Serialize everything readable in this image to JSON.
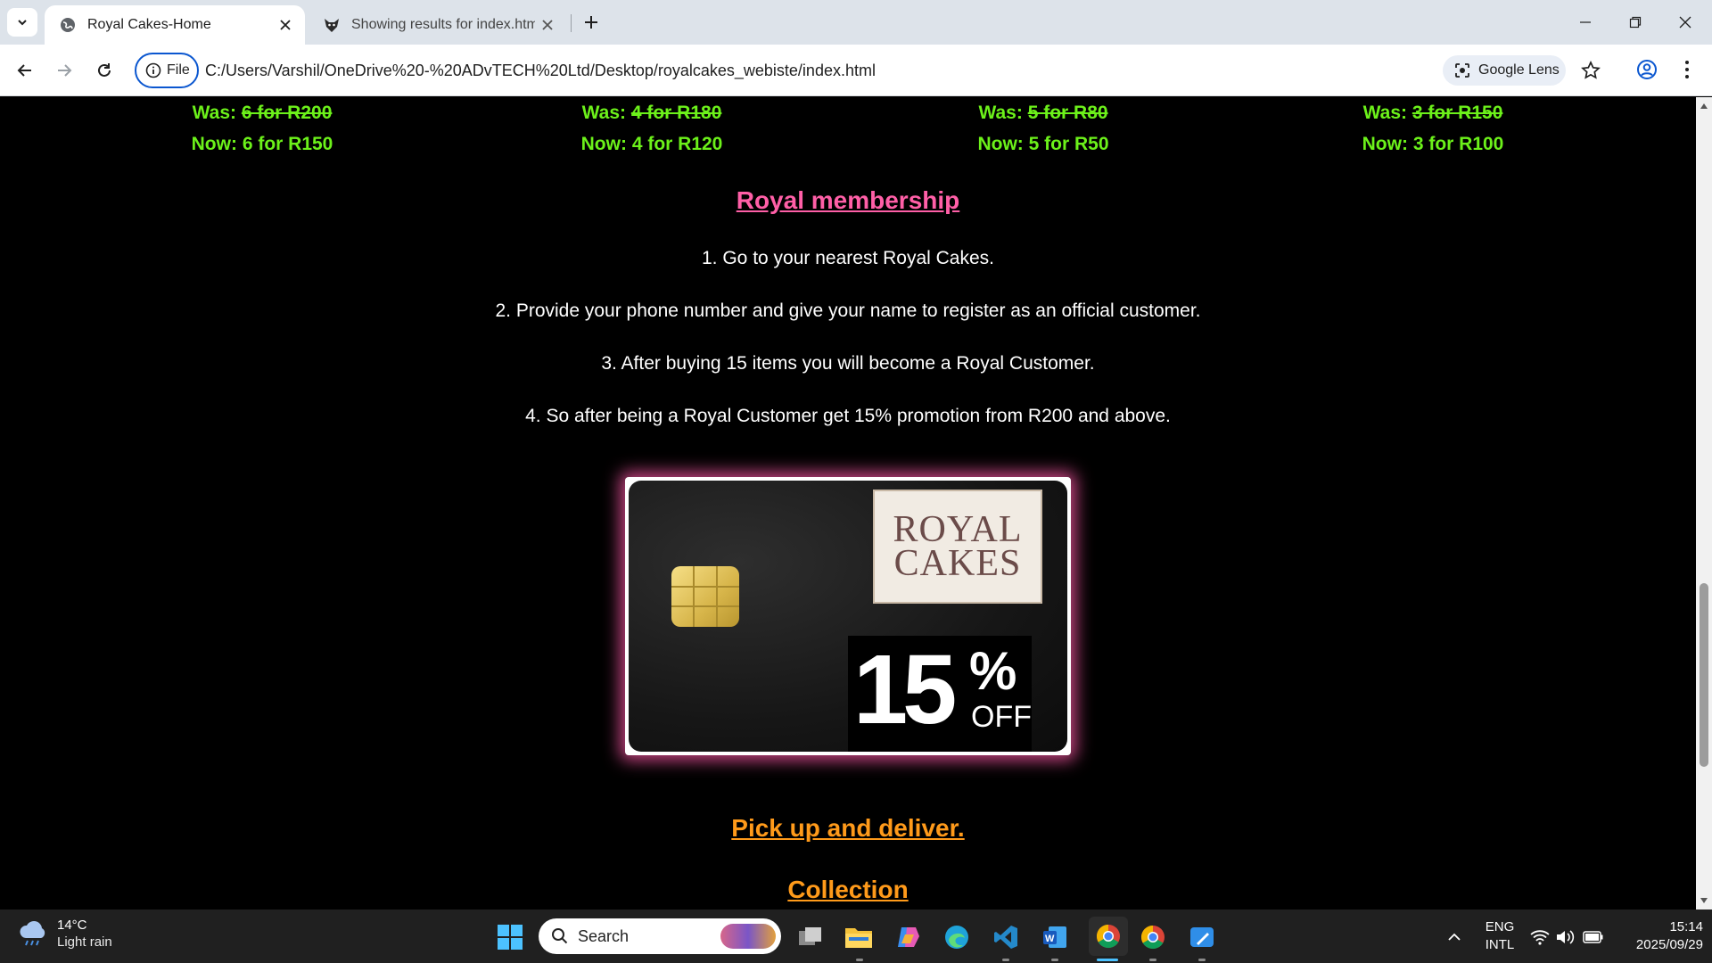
{
  "browser": {
    "tabs": [
      {
        "title": "Royal Cakes-Home",
        "active": true
      },
      {
        "title": "Showing results for index.html",
        "active": false
      }
    ],
    "chip_label": "File",
    "url": "C:/Users/Varshil/OneDrive%20-%20ADvTECH%20Ltd/Desktop/royalcakes_webiste/index.html",
    "lens_label": "Google Lens"
  },
  "page": {
    "prices": [
      {
        "was_label": "Was:",
        "was_value": "6 for R200",
        "now_label": "Now:",
        "now_value": "6 for R150"
      },
      {
        "was_label": "Was:",
        "was_value": "4 for R180",
        "now_label": "Now:",
        "now_value": "4 for R120"
      },
      {
        "was_label": "Was:",
        "was_value": "5 for R80",
        "now_label": "Now:",
        "now_value": "5 for R50"
      },
      {
        "was_label": "Was:",
        "was_value": "3 for R150",
        "now_label": "Now:",
        "now_value": "3 for R100"
      }
    ],
    "membership_title": "Royal membership",
    "steps": [
      "1. Go to your nearest Royal Cakes.",
      "2. Provide your phone number and give your name to register as an official customer.",
      "3. After buying 15 items you will become a Royal Customer.",
      "4. So after being a Royal Customer get 15% promotion from R200 and above."
    ],
    "card": {
      "logo_line1": "ROYAL",
      "logo_line2": "CAKES",
      "discount_number": "15",
      "discount_symbol": "%",
      "discount_text": "OFF"
    },
    "pickup_title": "Pick up and deliver.",
    "collection_title": "Collection"
  },
  "taskbar": {
    "temperature": "14°C",
    "condition": "Light rain",
    "search_placeholder": "Search",
    "lang_line1": "ENG",
    "lang_line2": "INTL",
    "time": "15:14",
    "date": "2025/09/29"
  },
  "colors": {
    "price_green": "#6cf11a",
    "membership_pink": "#ff5fa7",
    "section_orange": "#ff9a1a",
    "card_glow": "#c2437f"
  },
  "scroll_position_fraction": 0.6
}
